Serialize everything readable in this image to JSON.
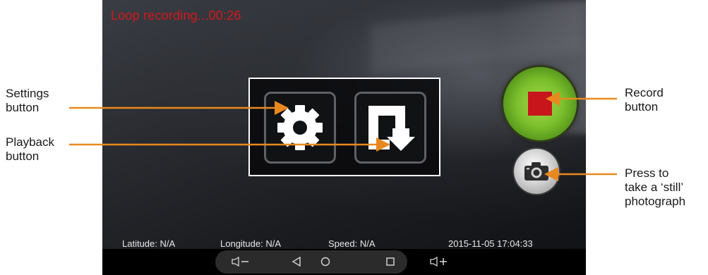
{
  "screen": {
    "recording_status": "Loop recording...00:26",
    "status_bar": {
      "latitude": "Latitude: N/A",
      "longitude": "Longitude: N/A",
      "speed": "Speed: N/A",
      "datetime": "2015-11-05  17:04:33"
    }
  },
  "menu": {
    "settings_icon": "gear-icon",
    "playback_icon": "playback-arrow-icon"
  },
  "controls": {
    "record_icon": "stop-square-icon",
    "photo_icon": "camera-icon"
  },
  "navbar": {
    "keys": [
      "volume-down-icon",
      "back-icon",
      "home-icon",
      "recents-icon",
      "volume-up-icon"
    ]
  },
  "callouts": {
    "settings": [
      "Settings",
      "button"
    ],
    "playback": [
      "Playback",
      "button"
    ],
    "record": [
      "Record",
      "button"
    ],
    "photo": [
      "Press to",
      "take a ‘still’",
      "photograph"
    ]
  },
  "colors": {
    "recording_text": "#d4181c",
    "record_button": "#7bbf2c",
    "stop_square": "#c8151b",
    "callout_line": "#e8891f"
  }
}
